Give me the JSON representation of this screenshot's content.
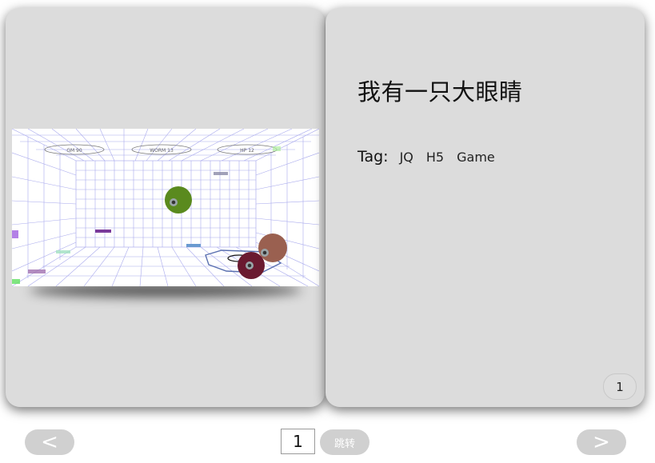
{
  "left_page": {
    "screenshot": {
      "hud_labels": [
        "GM 90",
        "WORM 13",
        "HP 12"
      ]
    }
  },
  "right_page": {
    "title": "我有一只大眼睛",
    "tag_label": "Tag:",
    "tags": [
      "JQ",
      "H5",
      "Game"
    ],
    "page_number": "1"
  },
  "pager": {
    "prev_label": "<",
    "next_label": ">",
    "page_input_value": "1",
    "jump_label": "跳转"
  },
  "colors": {
    "page_bg": "#dcdcdc",
    "button_bg": "#d0d0d0",
    "ball_green": "#5a8a1e",
    "ball_brown": "#9a6050",
    "ball_maroon": "#6a1a30",
    "grid": "#8f90e8"
  }
}
